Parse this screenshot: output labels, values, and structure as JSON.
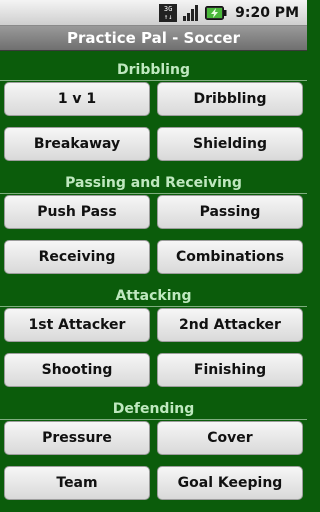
{
  "status_bar": {
    "network_label_top": "3G",
    "network_label_bottom": "↑↓",
    "time": "9:20 PM"
  },
  "app": {
    "title": "Practice Pal - Soccer"
  },
  "sections": [
    {
      "header": "Dribbling",
      "buttons": [
        "1 v 1",
        "Dribbling",
        "Breakaway",
        "Shielding"
      ]
    },
    {
      "header": "Passing and Receiving",
      "buttons": [
        "Push Pass",
        "Passing",
        "Receiving",
        "Combinations"
      ]
    },
    {
      "header": "Attacking",
      "buttons": [
        "1st Attacker",
        "2nd Attacker",
        "Shooting",
        "Finishing"
      ]
    },
    {
      "header": "Defending",
      "buttons": [
        "Pressure",
        "Cover",
        "Team",
        "Goal Keeping"
      ]
    }
  ],
  "colors": {
    "background": "#0b5c0b",
    "header_text": "#bfe8bf",
    "title_bar": "#7f7f7f"
  }
}
